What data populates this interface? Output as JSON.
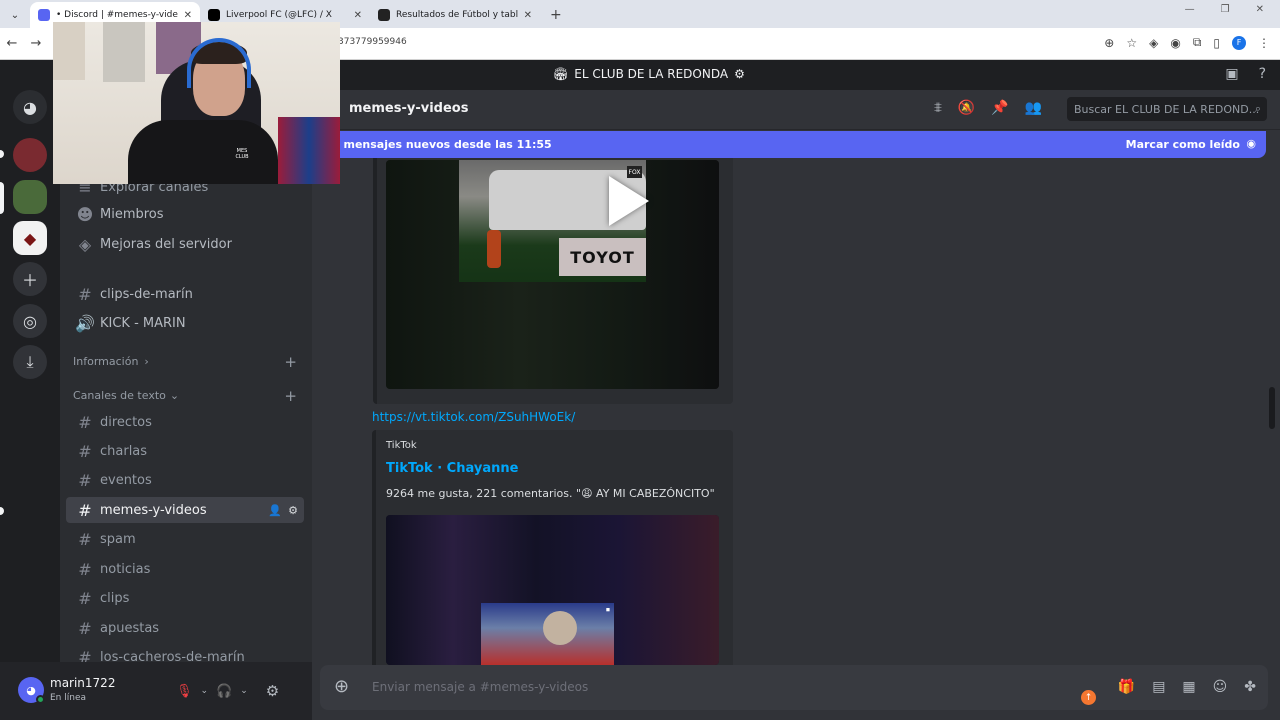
{
  "browser": {
    "tabs": [
      {
        "title": "• Discord | #memes-y-videos | E",
        "active": true,
        "favicon_color": "#5865f2"
      },
      {
        "title": "Liverpool FC (@LFC) / X",
        "active": false,
        "favicon_color": "#000000"
      },
      {
        "title": "Resultados de Fútbol y tabla de",
        "active": false,
        "favicon_color": "#222222"
      }
    ],
    "new_tab_label": "+",
    "url": "373779959946"
  },
  "server": {
    "name": "EL CLUB DE LA REDONDA"
  },
  "sidebar": {
    "top_items": [
      {
        "label": "Explorar canales",
        "icon": "browse-icon"
      },
      {
        "label": "Miembros",
        "icon": "members-icon"
      },
      {
        "label": "Mejoras del servidor",
        "icon": "boost-icon"
      }
    ],
    "voice_channels": [
      {
        "label": "clips-de-marín",
        "icon": "hash-icon"
      },
      {
        "label": "KICK - MARIN",
        "icon": "speaker-icon"
      }
    ],
    "categories": {
      "info": "Información",
      "text": "Canales de texto"
    },
    "text_channels": [
      {
        "label": "directos",
        "active": false
      },
      {
        "label": "charlas",
        "active": false
      },
      {
        "label": "eventos",
        "active": false
      },
      {
        "label": "memes-y-videos",
        "active": true
      },
      {
        "label": "spam",
        "active": false
      },
      {
        "label": "noticias",
        "active": false
      },
      {
        "label": "clips",
        "active": false
      },
      {
        "label": "apuestas",
        "active": false
      },
      {
        "label": "los-cacheros-de-marín",
        "active": false
      }
    ]
  },
  "user": {
    "name": "marin1722",
    "status": "En línea"
  },
  "channel": {
    "name": "memes-y-videos",
    "search_placeholder": "Buscar EL CLUB DE LA REDOND..."
  },
  "new_messages_bar": {
    "text": "4 mensajes nuevos desde las 11:55",
    "action": "Marcar como leído"
  },
  "messages": {
    "video1_plate": "TOYOT",
    "video1_logo": "FOX",
    "link": "https://vt.tiktok.com/ZSuhHWoEk/",
    "embed": {
      "provider": "TikTok",
      "title": "TikTok · Chayanne",
      "description": "9264 me gusta, 221 comentarios. \"😩 AY MI CABEZÓNCITO\""
    }
  },
  "composer": {
    "placeholder": "Enviar mensaje a #memes-y-videos"
  },
  "webcam": {
    "shirt_text": "MES CLUB",
    "flag_text": "FCBARCELONA"
  },
  "colors": {
    "accent": "#5865f2",
    "link": "#00a8fc",
    "online": "#23a55a",
    "muted_red": "#f23f43"
  }
}
